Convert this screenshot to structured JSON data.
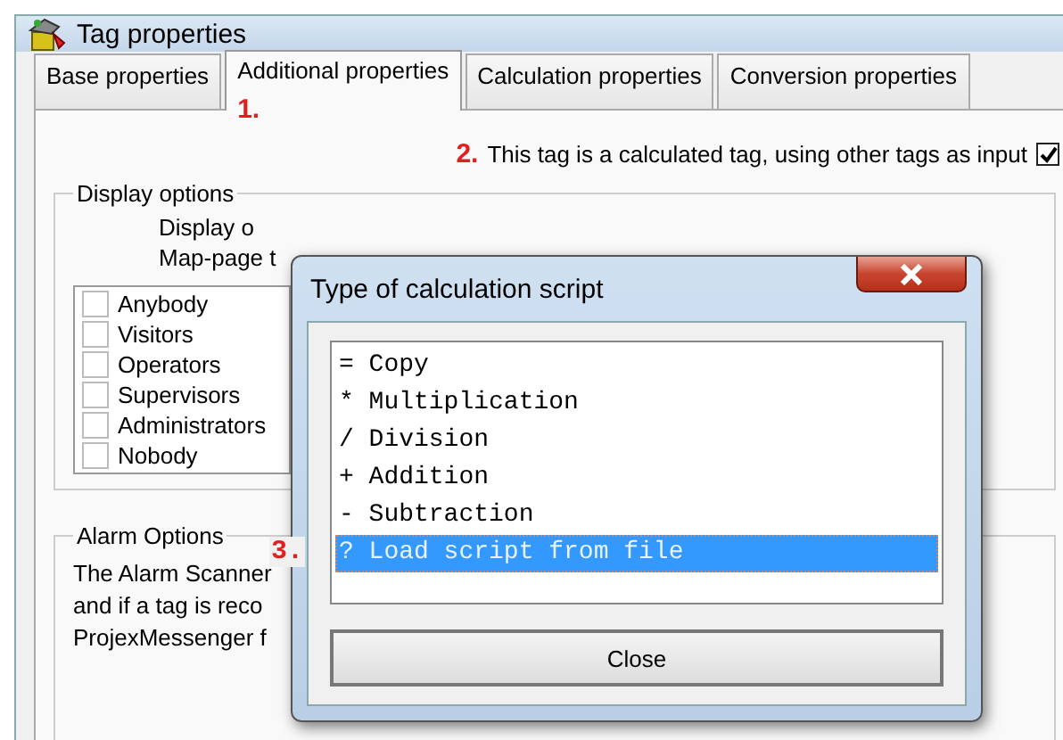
{
  "window": {
    "title": "Tag properties"
  },
  "tabs": [
    {
      "label": "Base properties",
      "selected": false
    },
    {
      "label": "Additional properties",
      "selected": true,
      "marker": "1."
    },
    {
      "label": "Calculation properties",
      "selected": false
    },
    {
      "label": "Conversion properties",
      "selected": false
    }
  ],
  "calculated_option": {
    "marker": "2.",
    "label": "This tag is a calculated tag, using other tags as input",
    "checked": true
  },
  "display_options": {
    "title": "Display options",
    "lines": [
      "Display o",
      "Map-page t"
    ],
    "roles": [
      {
        "label": "Anybody",
        "checked": false
      },
      {
        "label": "Visitors",
        "checked": false
      },
      {
        "label": "Operators",
        "checked": false
      },
      {
        "label": "Supervisors",
        "checked": false
      },
      {
        "label": "Administrators",
        "checked": false
      },
      {
        "label": "Nobody",
        "checked": false
      }
    ]
  },
  "alarm_options": {
    "title": "Alarm Options",
    "lines": [
      "The Alarm Scanner",
      "and if a tag is reco",
      "ProjexMessenger f"
    ]
  },
  "dialog": {
    "title": "Type of calculation script",
    "items": [
      {
        "label": "= Copy",
        "selected": false
      },
      {
        "label": "* Multiplication",
        "selected": false
      },
      {
        "label": "/ Division",
        "selected": false
      },
      {
        "label": "+ Addition",
        "selected": false
      },
      {
        "label": "- Subtraction",
        "selected": false
      },
      {
        "label": "? Load script from file",
        "selected": true,
        "marker": "3."
      }
    ],
    "button": "Close"
  }
}
